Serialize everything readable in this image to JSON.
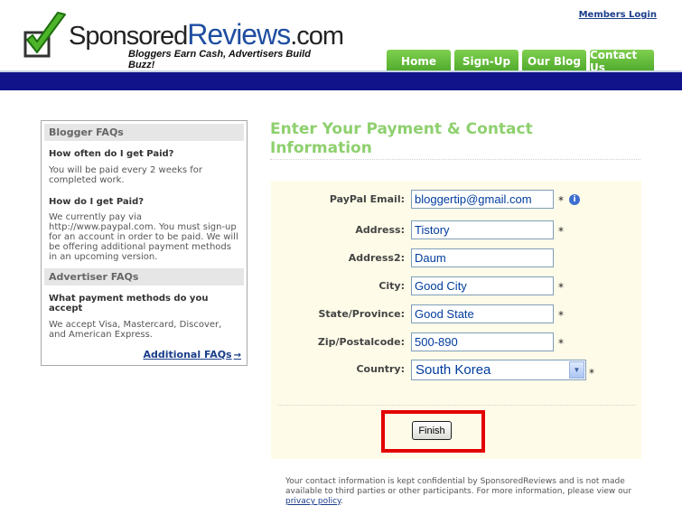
{
  "header": {
    "logo_prefix": "Sponsored",
    "logo_highlight": "Reviews",
    "logo_suffix": ".com",
    "tagline": "Bloggers Earn Cash, Advertisers Build Buzz!",
    "members_login": "Members Login",
    "nav": [
      {
        "label": "Home"
      },
      {
        "label": "Sign-Up"
      },
      {
        "label": "Our Blog"
      },
      {
        "label": "Contact Us"
      }
    ]
  },
  "sidebar": {
    "blogger_header": "Blogger FAQs",
    "faqs": [
      {
        "q": "How often do I get Paid?",
        "a": "You will be paid every 2 weeks for completed work."
      },
      {
        "q": "How do I get Paid?",
        "a": "We currently pay via http://www.paypal.com. You must sign-up for an account in order to be paid. We will be offering additional payment methods in an upcoming version."
      }
    ],
    "advertiser_header": "Advertiser FAQs",
    "advertiser_faq": {
      "q": "What payment methods do you accept",
      "a": "We accept Visa, Mastercard, Discover, and American Express."
    },
    "additional_link": "Additional FAQs",
    "arrow_icon": "arrow-right-icon"
  },
  "main": {
    "title": "Enter Your Payment & Contact Information",
    "required_mark": "*",
    "info_icon": "i",
    "fields": {
      "paypal": {
        "label": "PayPal Email:",
        "value": "bloggertip@gmail.com"
      },
      "address": {
        "label": "Address:",
        "value": "Tistory"
      },
      "address2": {
        "label": "Address2:",
        "value": "Daum"
      },
      "city": {
        "label": "City:",
        "value": "Good City"
      },
      "state": {
        "label": "State/Province:",
        "value": "Good State"
      },
      "zip": {
        "label": "Zip/Postalcode:",
        "value": "500-890"
      },
      "country": {
        "label": "Country:",
        "value": "South Korea"
      }
    },
    "finish_label": "Finish",
    "footnote": "Your contact information is kept confidential by SponsoredReviews and is not made available to third parties or other participants. For more information, please view our",
    "privacy_link": "privacy policy",
    "footnote_end": "."
  },
  "colors": {
    "nav_green": "#5cb534",
    "blue_bar": "#10138a",
    "title_green": "#8ed06e",
    "form_bg": "#fefce8",
    "highlight_red": "#e20000"
  }
}
